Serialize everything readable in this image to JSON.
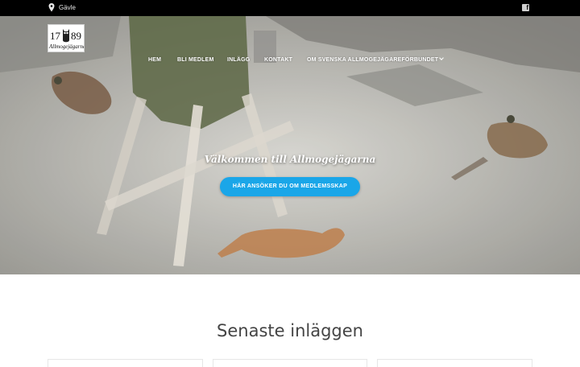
{
  "topbar": {
    "location": "Gävle",
    "location_icon": "map-pin-icon",
    "social_icon": "facebook-icon",
    "facebook_letter": "f"
  },
  "logo": {
    "year_left": "17",
    "year_right": "89",
    "name": "Allmogejägarna"
  },
  "nav": {
    "items": [
      {
        "label": "HEM"
      },
      {
        "label": "BLI MEDLEM"
      },
      {
        "label": "INLÄGG"
      },
      {
        "label": "KONTAKT"
      },
      {
        "label": "OM SVENSKA ALLMOGEJÄGAREFÖRBUNDET"
      }
    ]
  },
  "hero": {
    "welcome": "Välkommen till Allmogejägarna",
    "cta_label": "HÄR ANSÖKER DU OM MEDLEMSSKAP"
  },
  "latest": {
    "title": "Senaste inläggen"
  },
  "colors": {
    "accent": "#1aa6e8",
    "topbar": "#000000",
    "title": "#444444"
  }
}
